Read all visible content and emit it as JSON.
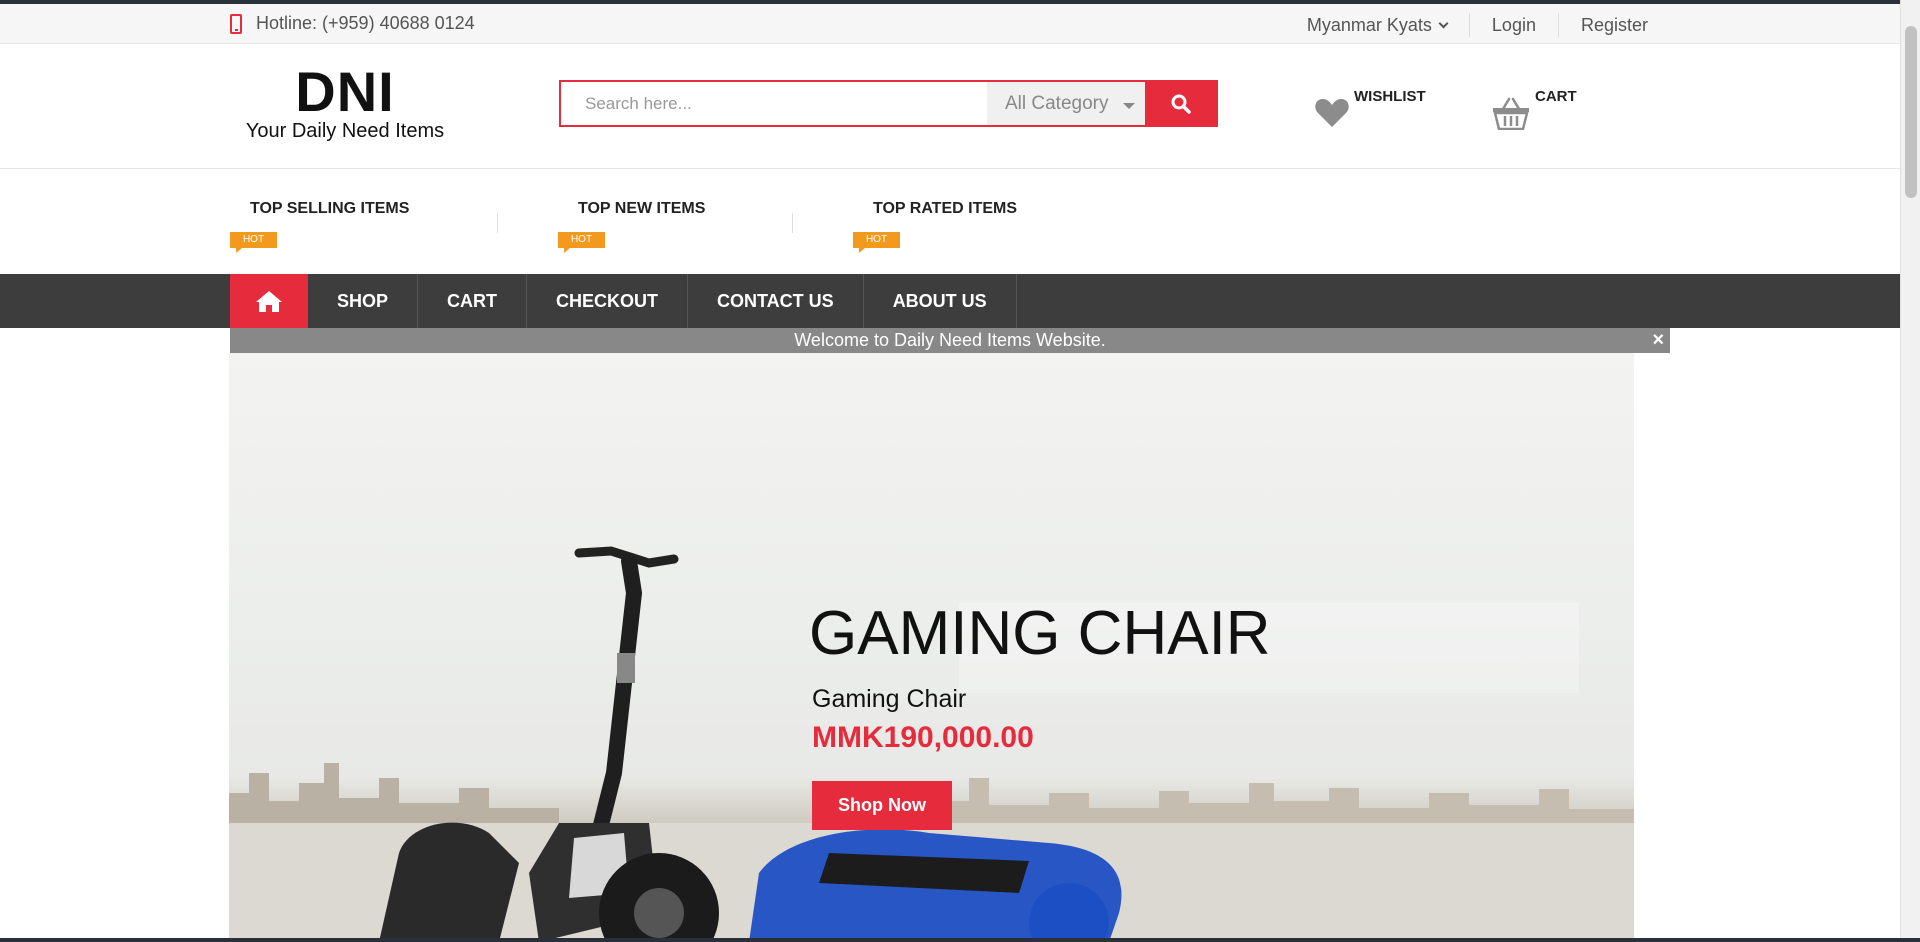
{
  "topbar": {
    "hotline": "Hotline: (+959) 40688 0124",
    "currency": "Myanmar Kyats",
    "login": "Login",
    "register": "Register"
  },
  "header": {
    "logo_mark": "DNI",
    "logo_tagline": "Your Daily Need Items",
    "search_placeholder": "Search here...",
    "category": "All Category",
    "wishlist": "WISHLIST",
    "cart": "CART"
  },
  "tabs": [
    {
      "label": "TOP SELLING ITEMS",
      "badge": "HOT"
    },
    {
      "label": "TOP NEW ITEMS",
      "badge": "HOT"
    },
    {
      "label": "TOP RATED ITEMS",
      "badge": "HOT"
    }
  ],
  "nav": {
    "items": [
      "SHOP",
      "CART",
      "CHECKOUT",
      "CONTACT US",
      "ABOUT US"
    ]
  },
  "welcome": {
    "text": "Welcome to Daily Need Items Website.",
    "close": "×"
  },
  "hero": {
    "title": "GAMING CHAIR",
    "subtitle": "Gaming Chair",
    "price": "MMK190,000.00",
    "cta": "Shop Now"
  },
  "colors": {
    "accent": "#e52b3c",
    "nav_bg": "#3d3d3d",
    "hot_badge": "#f39a1e"
  }
}
